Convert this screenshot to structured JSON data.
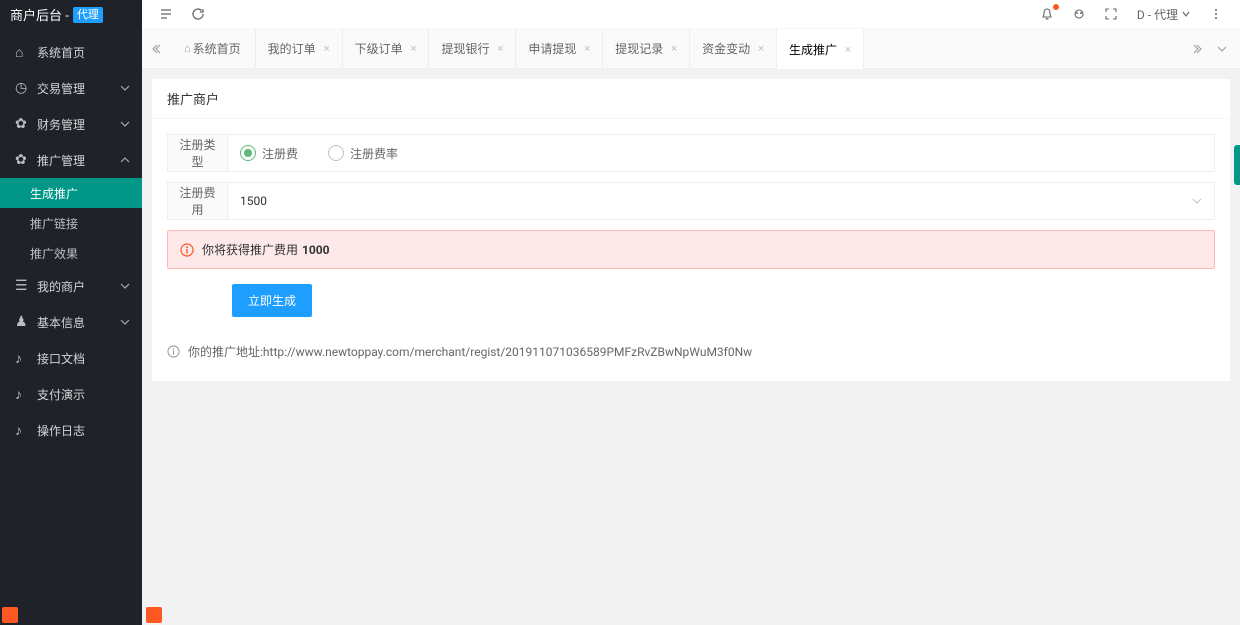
{
  "brand": {
    "title": "商户后台 -",
    "badge": "代理"
  },
  "sidebar": {
    "items": [
      {
        "label": "系统首页",
        "icon": "home"
      },
      {
        "label": "交易管理",
        "icon": "chart"
      },
      {
        "label": "财务管理",
        "icon": "gear"
      },
      {
        "label": "推广管理",
        "icon": "gear",
        "expanded": true,
        "children": [
          {
            "label": "生成推广",
            "active": true
          },
          {
            "label": "推广链接"
          },
          {
            "label": "推广效果"
          }
        ]
      },
      {
        "label": "我的商户",
        "icon": "list"
      },
      {
        "label": "基本信息",
        "icon": "user"
      },
      {
        "label": "接口文档",
        "icon": "bell"
      },
      {
        "label": "支付演示",
        "icon": "bell"
      },
      {
        "label": "操作日志",
        "icon": "bell"
      }
    ]
  },
  "topbar": {
    "user": "D - 代理"
  },
  "tabs": [
    {
      "label": "系统首页",
      "home": true
    },
    {
      "label": "我的订单"
    },
    {
      "label": "下级订单"
    },
    {
      "label": "提现银行"
    },
    {
      "label": "申请提现"
    },
    {
      "label": "提现记录"
    },
    {
      "label": "资金变动"
    },
    {
      "label": "生成推广",
      "active": true
    }
  ],
  "card": {
    "title": "推广商户",
    "form": {
      "type_label": "注册类型",
      "radio1": "注册费",
      "radio2": "注册费率",
      "fee_label": "注册费用",
      "fee_value": "1500"
    },
    "alert": {
      "text": "你将获得推广费用",
      "value": "1000"
    },
    "button": "立即生成",
    "url_label": "你的推广地址: ",
    "url_value": "http://www.newtoppay.com/merchant/regist/201911071036589PMFzRvZBwNpWuM3f0Nw"
  }
}
